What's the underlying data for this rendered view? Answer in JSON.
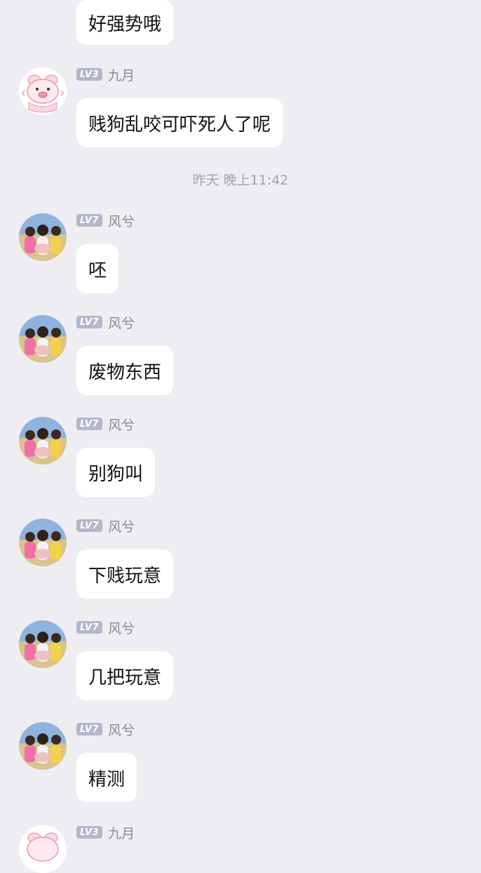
{
  "colors": {
    "background": "#EEEDF2",
    "bubble": "#FFFFFF",
    "level_badge": "#B3B7C9",
    "username": "#8A8A90",
    "timestamp": "#A2A2A8"
  },
  "timestamp": "昨天 晚上11:42",
  "messages": [
    {
      "avatar": "pink-pig-avatar",
      "level": "",
      "name": "",
      "text": "好强势哦"
    },
    {
      "avatar": "pink-pig-avatar",
      "level": "LV3",
      "name": "九月",
      "text": "贱狗乱咬可吓死人了呢"
    },
    {
      "avatar": "group-photo-avatar",
      "level": "LV7",
      "name": "风兮",
      "text": "呸"
    },
    {
      "avatar": "group-photo-avatar",
      "level": "LV7",
      "name": "风兮",
      "text": "废物东西"
    },
    {
      "avatar": "group-photo-avatar",
      "level": "LV7",
      "name": "风兮",
      "text": "别狗叫"
    },
    {
      "avatar": "group-photo-avatar",
      "level": "LV7",
      "name": "风兮",
      "text": "下贱玩意"
    },
    {
      "avatar": "group-photo-avatar",
      "level": "LV7",
      "name": "风兮",
      "text": "几把玩意"
    },
    {
      "avatar": "group-photo-avatar",
      "level": "LV7",
      "name": "风兮",
      "text": "精测"
    },
    {
      "avatar": "pink-pig-avatar",
      "level": "LV3",
      "name": "九月",
      "text": ""
    }
  ]
}
